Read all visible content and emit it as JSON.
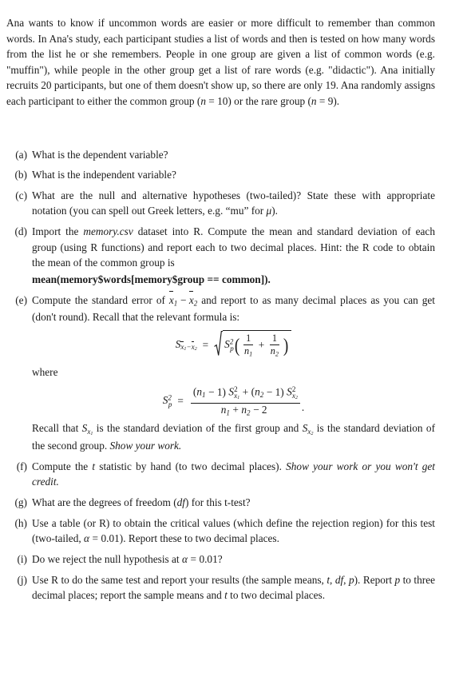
{
  "document": {
    "type": "statistics-homework-problem",
    "intro": {
      "text": "Ana wants to know if uncommon words are easier or more difficult to remember than common words. In Ana's study, each participant studies a list of words and then is tested on how many words from the list he or she remembers. People in one group are given a list of common words (e.g. \"muffin\"), while people in the other group get a list of rare words (e.g. \"didactic\"). Ana initially recruits 20 participants, but one of them doesn't show up, so there are only 19. Ana randomly assigns each participant to either the common group (n = 10) or the rare group (n = 9).",
      "segments": [
        "Ana wants to know if uncommon words are easier or more difficult to remember than common words. In Ana's study, each participant studies a list of words and then is tested on how many words from the list he or she remembers. People in one group are given a list of common words (e.g. \"muffin\"), while people in the other group get a list of rare words (e.g. \"didactic\"). Ana initially recruits 20 participants, but one of them doesn't show up, so there are only 19. Ana randomly assigns each participant to either the common group (",
        "n",
        " = 10) or the rare group (",
        "n",
        " = 9)."
      ],
      "participants_recruited": "20",
      "participants_actual": "19",
      "common_group_n": "10",
      "rare_group_n": "9",
      "example_common_word": "muffin",
      "example_rare_word": "didactic"
    },
    "items": [
      {
        "label": "(a)",
        "id": "item-a",
        "text": "What is the dependent variable?"
      },
      {
        "label": "(b)",
        "id": "item-b",
        "text": "What is the independent variable?"
      },
      {
        "label": "(c)",
        "id": "item-c",
        "text_before": "What are the null and alternative hypotheses (two-tailed)?  State these with appropriate notation (you can spell out Greek letters, e.g. “mu” for ",
        "symbol": "μ",
        "text_after": ")."
      },
      {
        "label": "(d)",
        "id": "item-d",
        "text_1": "Import the ",
        "dataset_name": "memory.csv",
        "text_2": " dataset into R. Compute the mean and standard deviation of each group (using R functions) and report each to two decimal places. Hint: the R code to obtain the mean of the common group is",
        "code": "mean(memory$words[memory$group == common])."
      },
      {
        "label": "(e)",
        "id": "item-e",
        "text_1": "Compute the standard error of ",
        "text_2": " and report to as many decimal places as you can get (don't round). Recall that the relevant formula is:",
        "where_label": "where",
        "text_3_a": "Recall that ",
        "text_3_b": " is the standard deviation of the first group and ",
        "text_3_c": " is the standard deviation of the second group. ",
        "emphasis": "Show your work."
      },
      {
        "label": "(f)",
        "id": "item-f",
        "text_1": "Compute the ",
        "stat_symbol": "t",
        "text_2": " statistic by hand (to two decimal places). ",
        "emphasis": "Show your work or you won't get credit."
      },
      {
        "label": "(g)",
        "id": "item-g",
        "text_1": "What are the degrees of freedom (",
        "df_symbol": "df",
        "text_2": ") for this t-test?"
      },
      {
        "label": "(h)",
        "id": "item-h",
        "text_1": "Use a table (or R) to obtain the critical values (which define the rejection region) for this test (two-tailed, ",
        "alpha_symbol": "α",
        "alpha_value": "0.01",
        "text_2": "). Report these to two decimal places."
      },
      {
        "label": "(i)",
        "id": "item-i",
        "text_1": "Do we reject the null hypothesis at ",
        "alpha_symbol": "α",
        "alpha_value": "0.01",
        "text_2": "?"
      },
      {
        "label": "(j)",
        "id": "item-j",
        "text_1": "Use R to do the same test and report your results (the sample means, ",
        "sym_t": "t",
        "sym_df": "df",
        "sym_p": "p",
        "text_2": "). Report ",
        "text_3": " to three decimal places; report the sample means and ",
        "text_4": " to two decimal places."
      }
    ],
    "equations": {
      "standard_error": {
        "lhs_S": "S",
        "lhs_sub_x1": "x",
        "lhs_sub_1": "1",
        "lhs_minus": "−",
        "lhs_sub_x2": "x",
        "lhs_sub_2": "2",
        "equals": "=",
        "radicand_S": "S",
        "radicand_sup": "2",
        "radicand_sub": "p",
        "frac1_num": "1",
        "frac1_den_n": "n",
        "frac1_den_sub": "1",
        "plus": "+",
        "frac2_num": "1",
        "frac2_den_n": "n",
        "frac2_den_sub": "2"
      },
      "pooled_variance": {
        "lhs_S": "S",
        "lhs_sup": "2",
        "lhs_sub": "p",
        "equals": "=",
        "num_open": "(",
        "num_n1": "n",
        "num_n1_sub": "1",
        "num_minus1": "− 1)",
        "num_S1": "S",
        "num_S1_sup": "2",
        "num_S1_sub_x": "x",
        "num_S1_sub_1": "1",
        "num_plus": "+",
        "num_open2": "(",
        "num_n2": "n",
        "num_n2_sub": "2",
        "num_minus1b": "− 1)",
        "num_S2": "S",
        "num_S2_sup": "2",
        "num_S2_sub_x": "x",
        "num_S2_sub_2": "2",
        "den_n1": "n",
        "den_n1_sub": "1",
        "den_plus": "+",
        "den_n2": "n",
        "den_n2_sub": "2",
        "den_minus": "− 2",
        "trailing_period": "."
      }
    }
  }
}
